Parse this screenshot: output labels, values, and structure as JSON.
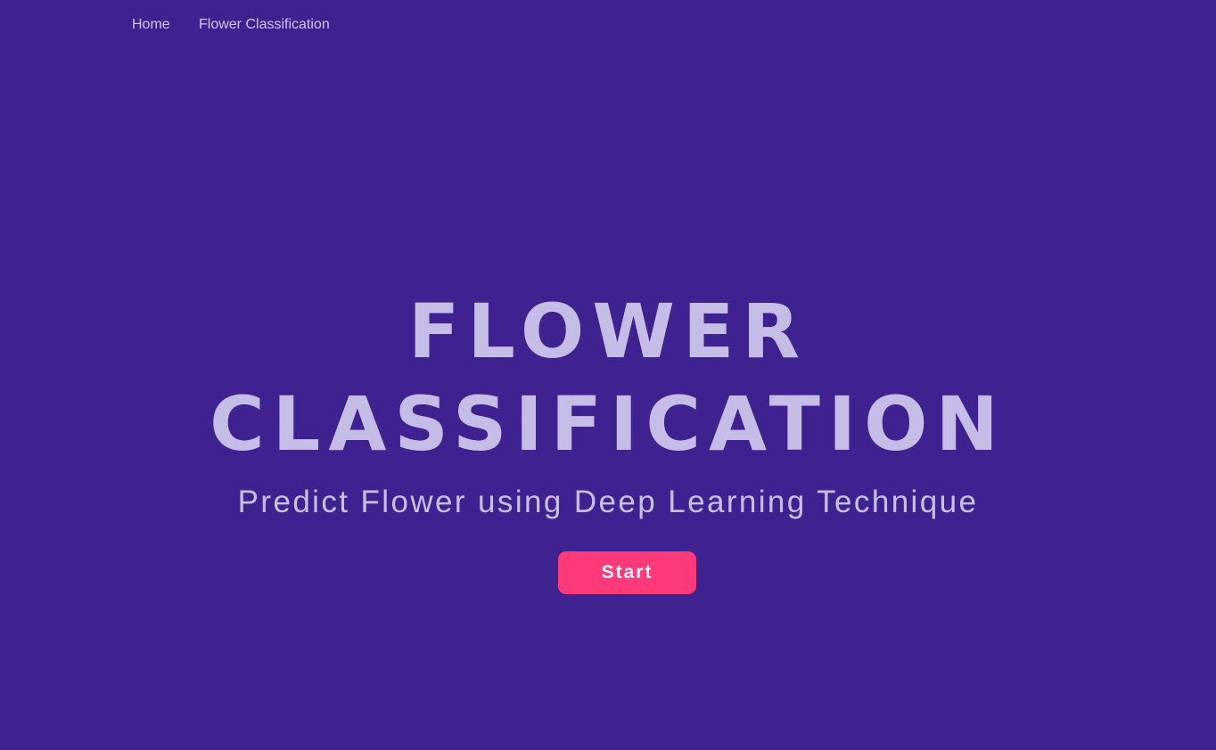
{
  "nav": {
    "links": [
      {
        "label": "Home"
      },
      {
        "label": "Flower Classification"
      }
    ]
  },
  "hero": {
    "title_line1": "FLOWER",
    "title_line2": "CLASSIFICATION",
    "subtitle": "Predict Flower using Deep Learning Technique",
    "cta_label": "Start"
  },
  "colors": {
    "background": "#3f228f",
    "title": "#c6bce8",
    "nav_text": "#d1c7f1",
    "button": "#ff3a7a",
    "button_text": "#fff7fb"
  }
}
